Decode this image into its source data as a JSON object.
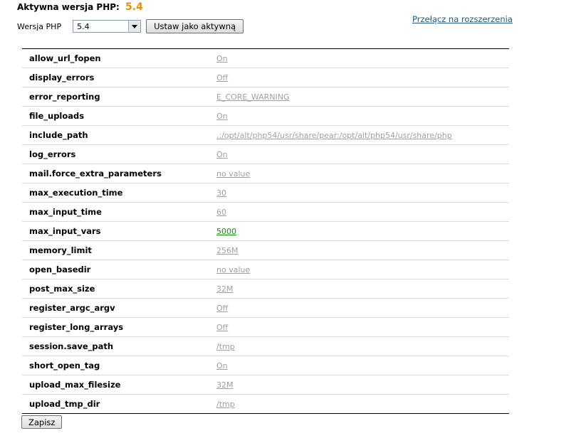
{
  "header": {
    "title_label": "Aktywna wersja PHP:",
    "active_version": "5.4"
  },
  "version_selector": {
    "label": "Wersja PHP",
    "selected": "5.4",
    "set_active_label": "Ustaw jako aktywną"
  },
  "switch_link": "Przełącz na rozszerzenia",
  "settings": [
    {
      "name": "allow_url_fopen",
      "value": "On"
    },
    {
      "name": "display_errors",
      "value": "Off"
    },
    {
      "name": "error_reporting",
      "value": "E_CORE_WARNING"
    },
    {
      "name": "file_uploads",
      "value": "On"
    },
    {
      "name": "include_path",
      "value": ".:/opt/alt/php54/usr/share/pear:/opt/alt/php54/usr/share/php"
    },
    {
      "name": "log_errors",
      "value": "On"
    },
    {
      "name": "mail.force_extra_parameters",
      "value": "no value"
    },
    {
      "name": "max_execution_time",
      "value": "30"
    },
    {
      "name": "max_input_time",
      "value": "60"
    },
    {
      "name": "max_input_vars",
      "value": "5000"
    },
    {
      "name": "memory_limit",
      "value": "256M"
    },
    {
      "name": "open_basedir",
      "value": "no value"
    },
    {
      "name": "post_max_size",
      "value": "32M"
    },
    {
      "name": "register_argc_argv",
      "value": "Off"
    },
    {
      "name": "register_long_arrays",
      "value": "Off"
    },
    {
      "name": "session.save_path",
      "value": "/tmp"
    },
    {
      "name": "short_open_tag",
      "value": "On"
    },
    {
      "name": "upload_max_filesize",
      "value": "32M"
    },
    {
      "name": "upload_tmp_dir",
      "value": "/tmp"
    }
  ],
  "save_label": "Zapisz",
  "colors": {
    "accent": "#f08c00",
    "link": "#1a5a8a",
    "value_default": "#a0a0a0",
    "value_changed": "#1a8a1a"
  }
}
